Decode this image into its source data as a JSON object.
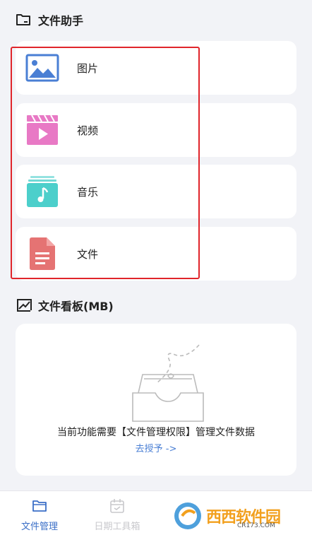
{
  "assistant": {
    "title": "文件助手",
    "items": [
      {
        "label": "图片",
        "icon": "image-icon"
      },
      {
        "label": "视频",
        "icon": "video-icon"
      },
      {
        "label": "音乐",
        "icon": "music-icon"
      },
      {
        "label": "文件",
        "icon": "document-icon"
      }
    ]
  },
  "board": {
    "title": "文件看板(MB)",
    "message": "当前功能需要【文件管理权限】管理文件数据",
    "link": "去授予 ->"
  },
  "tabbar": {
    "tabs": [
      {
        "label": "文件管理",
        "icon": "folder-icon",
        "active": true
      },
      {
        "label": "日期工具箱",
        "icon": "calendar-icon",
        "active": false
      }
    ]
  },
  "watermark": {
    "text": "西西软件园",
    "site": "CR173.COM"
  },
  "colors": {
    "accent": "#3b6fc7",
    "highlight": "#e0252b",
    "image": "#4a7fd4",
    "video": "#e879c5",
    "music": "#4ccfcb",
    "document": "#e57373",
    "background": "#f2f3f7"
  }
}
